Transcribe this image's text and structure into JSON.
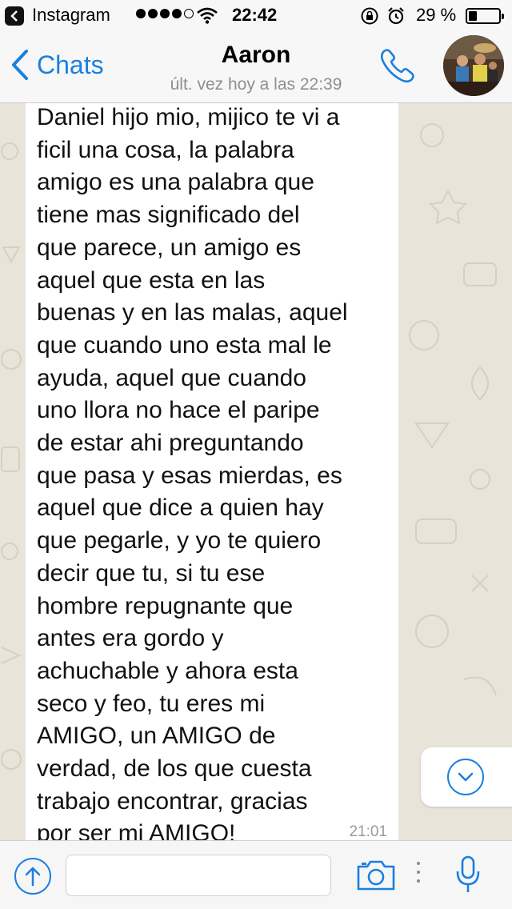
{
  "status_bar": {
    "back_app": "Instagram",
    "time": "22:42",
    "battery_text": "29 %",
    "battery_level": 0.29,
    "signal_filled": 4,
    "signal_total": 5,
    "icons": [
      "back-arrow-icon",
      "wifi-icon",
      "rotation-lock-icon",
      "alarm-icon",
      "battery-icon"
    ]
  },
  "nav": {
    "back_label": "Chats",
    "contact_name": "Aaron",
    "last_seen": "últ. vez hoy a las 22:39",
    "icons": [
      "chevron-left-icon",
      "phone-icon",
      "avatar"
    ]
  },
  "message": {
    "text": "Daniel hijo mio, mijico te vi a\nficil una cosa, la palabra\namigo es una palabra que\ntiene mas significado del\nque parece, un amigo es\naquel que esta en las\nbuenas y en las malas, aquel\nque cuando uno esta mal le\nayuda, aquel que cuando\nuno llora no hace el paripe\nde estar ahi preguntando\nque pasa y esas mierdas, es\naquel que dice a quien hay\nque pegarle, y yo te quiero\ndecir que tu, si tu ese\nhombre repugnante que\nantes era gordo y\nachuchable y ahora esta\nseco y feo, tu eres mi\nAMIGO, un AMIGO de\nverdad, de los que cuesta\ntrabajo encontrar, gracias\npor ser mi AMIGO!",
    "time": "21:01"
  },
  "composer": {
    "input_value": "",
    "input_placeholder": "",
    "icons": [
      "upload-icon",
      "camera-icon",
      "more-icon",
      "microphone-icon",
      "scroll-down-icon"
    ]
  },
  "colors": {
    "accent": "#1a7fe0",
    "chat_background": "#e9e4da",
    "bubble": "#ffffff",
    "bar_background": "#f7f7f7"
  }
}
